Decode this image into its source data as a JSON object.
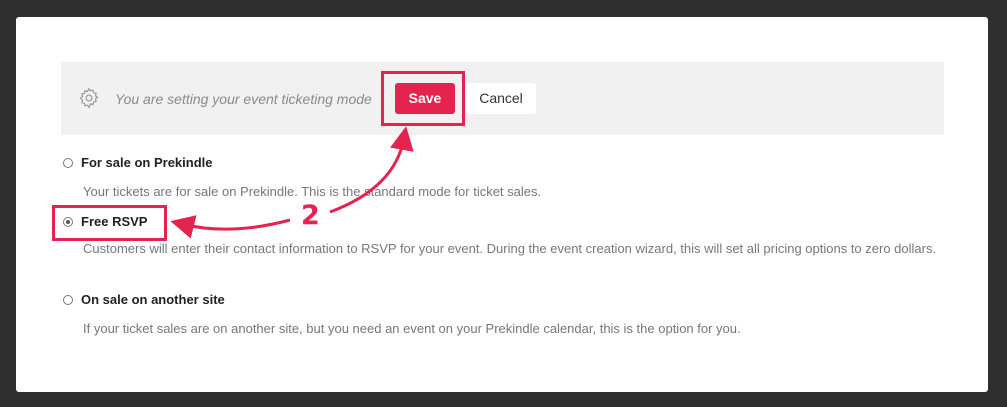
{
  "toolbar": {
    "gear_icon": "gear-icon",
    "message": "You are setting your event ticketing mode",
    "save_label": "Save",
    "cancel_label": "Cancel"
  },
  "options": [
    {
      "label": "For sale on Prekindle",
      "description": "Your tickets are for sale on Prekindle. This is the standard mode for ticket sales.",
      "selected": false
    },
    {
      "label": "Free RSVP",
      "description": "Customers will enter their contact information to RSVP for your event. During the event creation wizard, this will set all pricing options to zero dollars.",
      "selected": true
    },
    {
      "label": "On sale on another site",
      "description": "If your ticket sales are on another site, but you need an event on your Prekindle calendar, this is the option for you.",
      "selected": false
    }
  ],
  "annotation": {
    "step_number": "2",
    "color": "#e5234f"
  },
  "colors": {
    "accent": "#e5234f",
    "background": "#2f2f2f",
    "toolbar_bg": "#f1f1f1"
  }
}
